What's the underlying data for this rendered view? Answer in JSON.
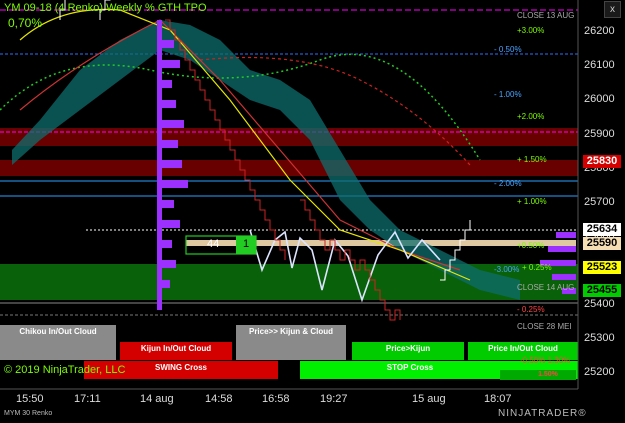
{
  "header": {
    "title": "YM 09-18 (4 Renko) Weekly % GTH TPO",
    "value": "0,70%"
  },
  "close_label": "x",
  "price_axis": [
    "26200",
    "26100",
    "26000",
    "25900",
    "25800",
    "25700",
    "25600",
    "25500",
    "25400",
    "25300",
    "25200"
  ],
  "time_axis": [
    "15:50",
    "17:11",
    "14 aug",
    "14:58",
    "16:58",
    "19:27",
    "15 aug",
    "18:07"
  ],
  "level_labels": [
    {
      "text": "CLOSE 13 AUG",
      "color": "#aaaaaa"
    },
    {
      "text": "+3.00%",
      "color": "#7CFC00"
    },
    {
      "text": "- 0.50%",
      "color": "#4aa3ff"
    },
    {
      "text": "- 1.00%",
      "color": "#4aa3ff"
    },
    {
      "text": "+2.00%",
      "color": "#7CFC00"
    },
    {
      "text": "+ 1.50%",
      "color": "#7CFC00"
    },
    {
      "text": "- 2.00%",
      "color": "#4aa3ff"
    },
    {
      "text": "+ 1.00%",
      "color": "#7CFC00"
    },
    {
      "text": "+0.50%",
      "color": "#7CFC00"
    },
    {
      "text": "-3.00%",
      "color": "#4aa3ff"
    },
    {
      "text": "+ 0.25%",
      "color": "#7CFC00"
    },
    {
      "text": "CLOSE 14 AUG",
      "color": "#aaaaaa"
    },
    {
      "text": "- 0.25%",
      "color": "#ff4444"
    },
    {
      "text": "CLOSE 28 MEI",
      "color": "#aaaaaa"
    },
    {
      "text": "-0.50% 1.30%",
      "color": "#ff4444"
    }
  ],
  "price_badges": [
    {
      "text": "25830",
      "bg": "#d40000",
      "fg": "#ffffff"
    },
    {
      "text": "25634",
      "bg": "#ffffff",
      "fg": "#000000"
    },
    {
      "text": "25590",
      "bg": "#f5deb3",
      "fg": "#000000"
    },
    {
      "text": "25523",
      "bg": "#ffff00",
      "fg": "#000000"
    },
    {
      "text": "25455",
      "bg": "#00cc00",
      "fg": "#000000"
    }
  ],
  "box": {
    "left": "44",
    "right": "1"
  },
  "panels": {
    "chikou": "Chikou In/Out Cloud",
    "kijun_cloud": "Kijun In/Out Cloud",
    "price_kijun_cloud": "Price>> Kijun & Cloud",
    "price_kijun": "Price>Kijun",
    "price_cloud": "Price In/Out Cloud",
    "swing": "SWING Cross",
    "stop": "STOP Cross",
    "small": "1.50%"
  },
  "footer": {
    "copyright": "© 2019 NinjaTrader, LLC",
    "series": "MYM 30 Renko",
    "logo": "NINJATRADER®"
  }
}
